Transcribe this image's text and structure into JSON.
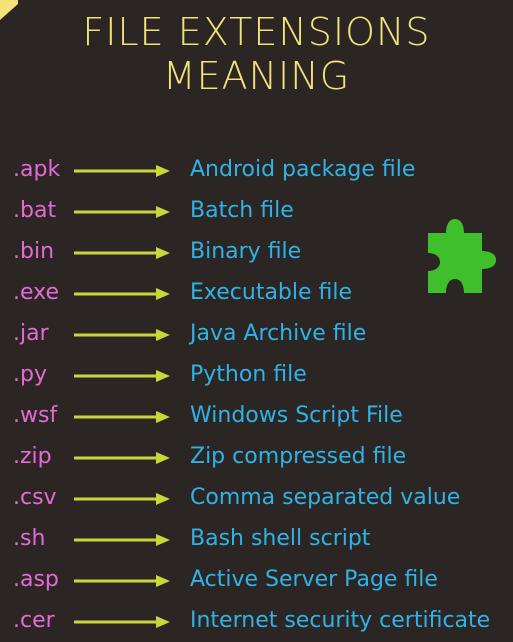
{
  "title": {
    "line1": "FILE EXTENSIONS",
    "line2": "MEANING"
  },
  "colors": {
    "background": "#2b2624",
    "title": "#f2e27a",
    "extension": "#e46ad5",
    "arrow": "#c9d63a",
    "meaning": "#2fb3e6",
    "puzzle": "#3fbf2c"
  },
  "icons": {
    "corner": "arrow-icon",
    "puzzle": "puzzle-piece-icon"
  },
  "rows": [
    {
      "ext": ".apk",
      "meaning": "Android package file"
    },
    {
      "ext": ".bat",
      "meaning": "Batch file"
    },
    {
      "ext": ".bin",
      "meaning": "Binary file"
    },
    {
      "ext": ".exe",
      "meaning": "Executable file"
    },
    {
      "ext": ".jar",
      "meaning": "Java Archive file"
    },
    {
      "ext": ".py",
      "meaning": "Python file"
    },
    {
      "ext": ".wsf",
      "meaning": "Windows Script File"
    },
    {
      "ext": ".zip",
      "meaning": "Zip compressed file"
    },
    {
      "ext": ".csv",
      "meaning": "Comma separated value"
    },
    {
      "ext": ".sh",
      "meaning": "Bash shell script"
    },
    {
      "ext": ".asp",
      "meaning": "Active Server Page file"
    },
    {
      "ext": ".cer",
      "meaning": "Internet security certificate"
    }
  ]
}
